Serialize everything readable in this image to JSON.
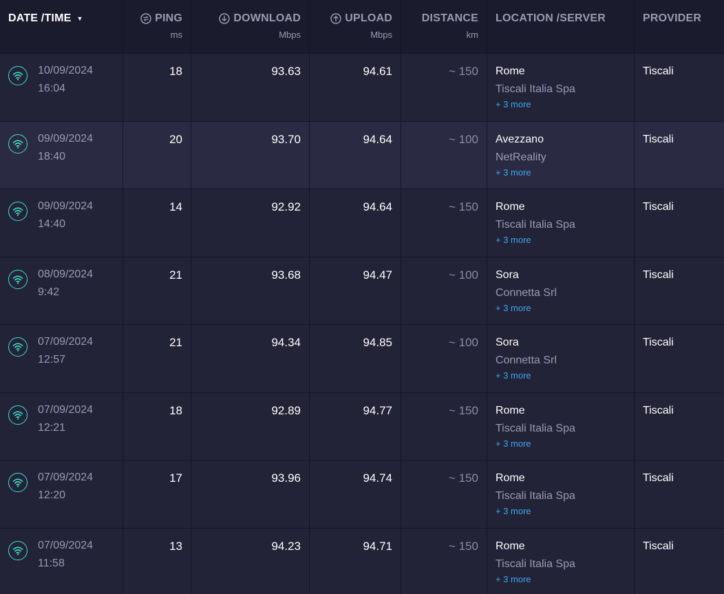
{
  "header": {
    "date": "DATE /TIME",
    "ping": "PING",
    "ping_unit": "ms",
    "download": "DOWNLOAD",
    "download_unit": "Mbps",
    "upload": "UPLOAD",
    "upload_unit": "Mbps",
    "distance": "DISTANCE",
    "distance_unit": "km",
    "location": "LOCATION /SERVER",
    "provider": "PROVIDER"
  },
  "colors": {
    "accent_wifi": "#3fe0c8",
    "link": "#3da6f0"
  },
  "rows": [
    {
      "date": "10/09/2024",
      "time": "16:04",
      "ping": "18",
      "download": "93.63",
      "upload": "94.61",
      "distance": "~ 150",
      "city": "Rome",
      "server": "Tiscali Italia Spa",
      "more": "+ 3 more",
      "provider": "Tiscali"
    },
    {
      "date": "09/09/2024",
      "time": "18:40",
      "ping": "20",
      "download": "93.70",
      "upload": "94.64",
      "distance": "~ 100",
      "city": "Avezzano",
      "server": "NetReality",
      "more": "+ 3 more",
      "provider": "Tiscali"
    },
    {
      "date": "09/09/2024",
      "time": "14:40",
      "ping": "14",
      "download": "92.92",
      "upload": "94.64",
      "distance": "~ 150",
      "city": "Rome",
      "server": "Tiscali Italia Spa",
      "more": "+ 3 more",
      "provider": "Tiscali"
    },
    {
      "date": "08/09/2024",
      "time": "9:42",
      "ping": "21",
      "download": "93.68",
      "upload": "94.47",
      "distance": "~ 100",
      "city": "Sora",
      "server": "Connetta Srl",
      "more": "+ 3 more",
      "provider": "Tiscali"
    },
    {
      "date": "07/09/2024",
      "time": "12:57",
      "ping": "21",
      "download": "94.34",
      "upload": "94.85",
      "distance": "~ 100",
      "city": "Sora",
      "server": "Connetta Srl",
      "more": "+ 3 more",
      "provider": "Tiscali"
    },
    {
      "date": "07/09/2024",
      "time": "12:21",
      "ping": "18",
      "download": "92.89",
      "upload": "94.77",
      "distance": "~ 150",
      "city": "Rome",
      "server": "Tiscali Italia Spa",
      "more": "+ 3 more",
      "provider": "Tiscali"
    },
    {
      "date": "07/09/2024",
      "time": "12:20",
      "ping": "17",
      "download": "93.96",
      "upload": "94.74",
      "distance": "~ 150",
      "city": "Rome",
      "server": "Tiscali Italia Spa",
      "more": "+ 3 more",
      "provider": "Tiscali"
    },
    {
      "date": "07/09/2024",
      "time": "11:58",
      "ping": "13",
      "download": "94.23",
      "upload": "94.71",
      "distance": "~ 150",
      "city": "Rome",
      "server": "Tiscali Italia Spa",
      "more": "+ 3 more",
      "provider": "Tiscali"
    }
  ]
}
